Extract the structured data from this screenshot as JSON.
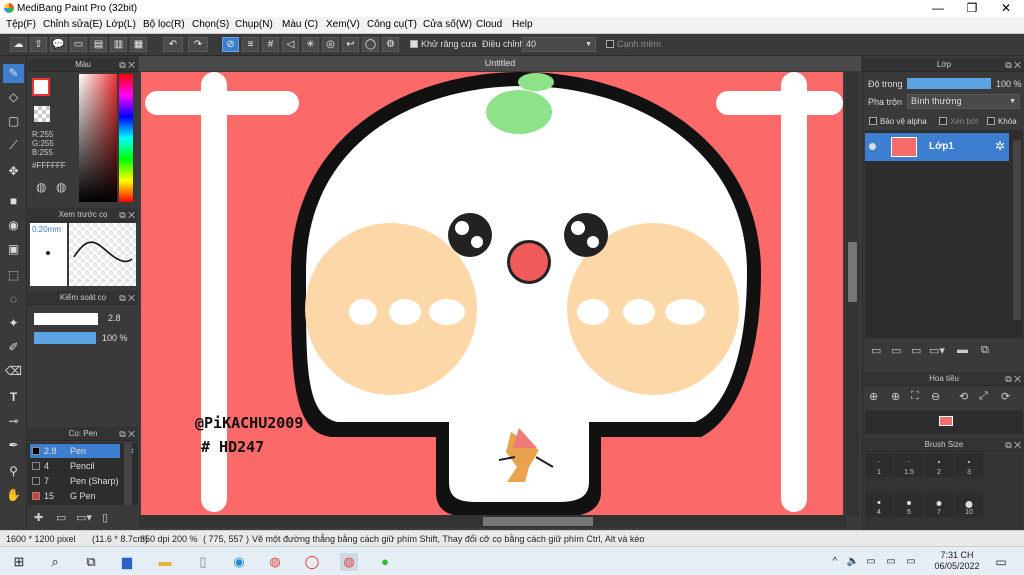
{
  "title": "MediBang Paint Pro (32bit)",
  "window_controls": {
    "minimize": "—",
    "restore": "❐",
    "close": "✕"
  },
  "menu": [
    "Tệp(F)",
    "Chỉnh sửa(E)",
    "Lớp(L)",
    "Bộ lọc(R)",
    "Chọn(S)",
    "Chụp(N)",
    "Màu (C)",
    "Xem(V)",
    "Công cụ(T)",
    "Cửa số(W)",
    "Cloud",
    "Help"
  ],
  "toolbar": {
    "antialias_label": "Khử răng cưa",
    "adjust_label": "Điều chỉnh",
    "adjust_value": "40",
    "edge_label": "Cạnh mềm"
  },
  "color_panel": {
    "title": "Màu",
    "r": "R:255",
    "g": "G:255",
    "b": "B:255",
    "hex": "#FFFFFF"
  },
  "brush_preview": {
    "title": "Xem trước cọ",
    "size": "0.20mm"
  },
  "brush_control": {
    "title": "Kiểm soát cọ",
    "size_value": "2.8",
    "opacity_value": "100 %",
    "opacity_fraction": 1.0
  },
  "brush_list": {
    "title": "Cọ: Pen",
    "items": [
      {
        "num": "2.8",
        "name": "Pen",
        "color": "#000000",
        "selected": true
      },
      {
        "num": "4",
        "name": "Pencil",
        "color": "#2b2b2b",
        "selected": false
      },
      {
        "num": "7",
        "name": "Pen (Sharp)",
        "color": "#2b2b2b",
        "selected": false
      },
      {
        "num": "15",
        "name": "G Pen",
        "color": "#e23a3a",
        "selected": false
      }
    ]
  },
  "document": {
    "tab": "Untitled",
    "signature_line1": "@PiKACHU2009",
    "signature_line2": "# HD247"
  },
  "layer_panel": {
    "title": "Lớp",
    "opacity_label": "Độ trong",
    "opacity_value": "100 %",
    "opacity_fraction": 1.0,
    "blend_label": "Pha trộn",
    "blend_value": "Bình thường",
    "protect_alpha": "Bảo vệ alpha",
    "clipping": "Xén bớt",
    "lock": "Khóa",
    "layers": [
      {
        "name": "Lớp1"
      }
    ]
  },
  "navigator": {
    "title": "Hoa tiêu"
  },
  "brush_size": {
    "title": "Brush Size",
    "sizes": [
      "1",
      "1.5",
      "2",
      "3",
      "4",
      "5",
      "7",
      "10"
    ]
  },
  "status": {
    "size": "1600 * 1200 pixel",
    "cm": "(11.6 * 8.7cm)",
    "dpi": "350 dpi",
    "zoom": "200 %",
    "coords": "( 775, 557 )",
    "hint": "Vẽ một đường thẳng bằng cách giữ phím Shift, Thay đổi cỡ cọ bằng cách giữ phím Ctrl, Alt và kéo"
  },
  "taskbar": {
    "time": "7:31 CH",
    "date": "06/05/2022"
  },
  "colors": {
    "canvas": "#fb6969",
    "accent": "#3d7ed0",
    "cheek": "#fcd7a8",
    "leaf": "#8de28a"
  }
}
